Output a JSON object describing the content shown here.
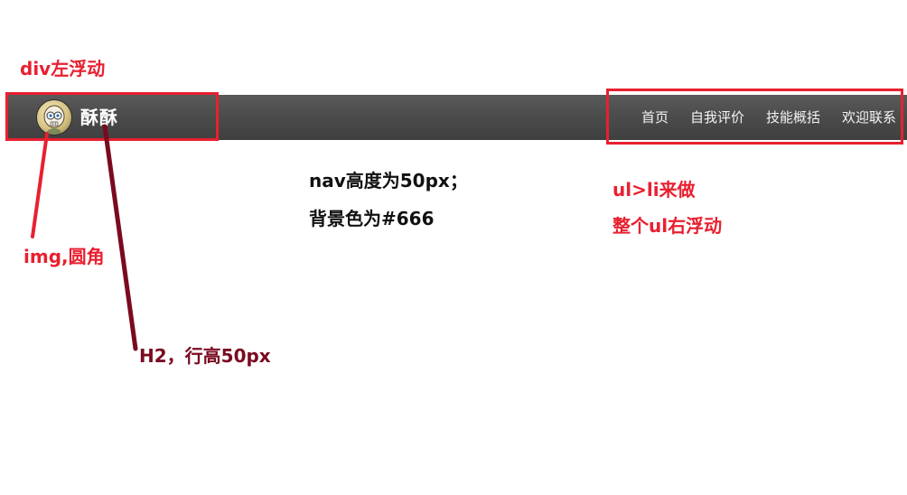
{
  "annotations": {
    "div_note": "div左浮动",
    "img_note": "img,圆角",
    "h2_note": "H2，行高50px",
    "nav_note_line1": "nav高度为50px；",
    "nav_note_line2": "背景色为#666",
    "ul_note_line1": "ul>li来做",
    "ul_note_line2": "整个ul右浮动"
  },
  "nav": {
    "brand_title": "酥酥",
    "avatar_icon": "skull-avatar-icon",
    "menu_items": [
      "首页",
      "自我评价",
      "技能概括",
      "欢迎联系"
    ]
  },
  "colors": {
    "nav_background": "#666",
    "annotation_red": "#e8202f",
    "annotation_darkred": "#7a0a20",
    "arrow_crimson": "#7a0a20"
  }
}
